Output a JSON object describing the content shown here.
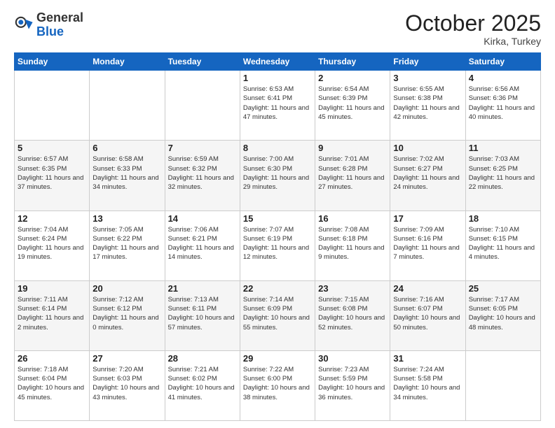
{
  "header": {
    "logo_general": "General",
    "logo_blue": "Blue",
    "month_title": "October 2025",
    "subtitle": "Kirka, Turkey"
  },
  "weekdays": [
    "Sunday",
    "Monday",
    "Tuesday",
    "Wednesday",
    "Thursday",
    "Friday",
    "Saturday"
  ],
  "weeks": [
    [
      {
        "day": "",
        "sunrise": "",
        "sunset": "",
        "daylight": ""
      },
      {
        "day": "",
        "sunrise": "",
        "sunset": "",
        "daylight": ""
      },
      {
        "day": "",
        "sunrise": "",
        "sunset": "",
        "daylight": ""
      },
      {
        "day": "1",
        "sunrise": "Sunrise: 6:53 AM",
        "sunset": "Sunset: 6:41 PM",
        "daylight": "Daylight: 11 hours and 47 minutes."
      },
      {
        "day": "2",
        "sunrise": "Sunrise: 6:54 AM",
        "sunset": "Sunset: 6:39 PM",
        "daylight": "Daylight: 11 hours and 45 minutes."
      },
      {
        "day": "3",
        "sunrise": "Sunrise: 6:55 AM",
        "sunset": "Sunset: 6:38 PM",
        "daylight": "Daylight: 11 hours and 42 minutes."
      },
      {
        "day": "4",
        "sunrise": "Sunrise: 6:56 AM",
        "sunset": "Sunset: 6:36 PM",
        "daylight": "Daylight: 11 hours and 40 minutes."
      }
    ],
    [
      {
        "day": "5",
        "sunrise": "Sunrise: 6:57 AM",
        "sunset": "Sunset: 6:35 PM",
        "daylight": "Daylight: 11 hours and 37 minutes."
      },
      {
        "day": "6",
        "sunrise": "Sunrise: 6:58 AM",
        "sunset": "Sunset: 6:33 PM",
        "daylight": "Daylight: 11 hours and 34 minutes."
      },
      {
        "day": "7",
        "sunrise": "Sunrise: 6:59 AM",
        "sunset": "Sunset: 6:32 PM",
        "daylight": "Daylight: 11 hours and 32 minutes."
      },
      {
        "day": "8",
        "sunrise": "Sunrise: 7:00 AM",
        "sunset": "Sunset: 6:30 PM",
        "daylight": "Daylight: 11 hours and 29 minutes."
      },
      {
        "day": "9",
        "sunrise": "Sunrise: 7:01 AM",
        "sunset": "Sunset: 6:28 PM",
        "daylight": "Daylight: 11 hours and 27 minutes."
      },
      {
        "day": "10",
        "sunrise": "Sunrise: 7:02 AM",
        "sunset": "Sunset: 6:27 PM",
        "daylight": "Daylight: 11 hours and 24 minutes."
      },
      {
        "day": "11",
        "sunrise": "Sunrise: 7:03 AM",
        "sunset": "Sunset: 6:25 PM",
        "daylight": "Daylight: 11 hours and 22 minutes."
      }
    ],
    [
      {
        "day": "12",
        "sunrise": "Sunrise: 7:04 AM",
        "sunset": "Sunset: 6:24 PM",
        "daylight": "Daylight: 11 hours and 19 minutes."
      },
      {
        "day": "13",
        "sunrise": "Sunrise: 7:05 AM",
        "sunset": "Sunset: 6:22 PM",
        "daylight": "Daylight: 11 hours and 17 minutes."
      },
      {
        "day": "14",
        "sunrise": "Sunrise: 7:06 AM",
        "sunset": "Sunset: 6:21 PM",
        "daylight": "Daylight: 11 hours and 14 minutes."
      },
      {
        "day": "15",
        "sunrise": "Sunrise: 7:07 AM",
        "sunset": "Sunset: 6:19 PM",
        "daylight": "Daylight: 11 hours and 12 minutes."
      },
      {
        "day": "16",
        "sunrise": "Sunrise: 7:08 AM",
        "sunset": "Sunset: 6:18 PM",
        "daylight": "Daylight: 11 hours and 9 minutes."
      },
      {
        "day": "17",
        "sunrise": "Sunrise: 7:09 AM",
        "sunset": "Sunset: 6:16 PM",
        "daylight": "Daylight: 11 hours and 7 minutes."
      },
      {
        "day": "18",
        "sunrise": "Sunrise: 7:10 AM",
        "sunset": "Sunset: 6:15 PM",
        "daylight": "Daylight: 11 hours and 4 minutes."
      }
    ],
    [
      {
        "day": "19",
        "sunrise": "Sunrise: 7:11 AM",
        "sunset": "Sunset: 6:14 PM",
        "daylight": "Daylight: 11 hours and 2 minutes."
      },
      {
        "day": "20",
        "sunrise": "Sunrise: 7:12 AM",
        "sunset": "Sunset: 6:12 PM",
        "daylight": "Daylight: 11 hours and 0 minutes."
      },
      {
        "day": "21",
        "sunrise": "Sunrise: 7:13 AM",
        "sunset": "Sunset: 6:11 PM",
        "daylight": "Daylight: 10 hours and 57 minutes."
      },
      {
        "day": "22",
        "sunrise": "Sunrise: 7:14 AM",
        "sunset": "Sunset: 6:09 PM",
        "daylight": "Daylight: 10 hours and 55 minutes."
      },
      {
        "day": "23",
        "sunrise": "Sunrise: 7:15 AM",
        "sunset": "Sunset: 6:08 PM",
        "daylight": "Daylight: 10 hours and 52 minutes."
      },
      {
        "day": "24",
        "sunrise": "Sunrise: 7:16 AM",
        "sunset": "Sunset: 6:07 PM",
        "daylight": "Daylight: 10 hours and 50 minutes."
      },
      {
        "day": "25",
        "sunrise": "Sunrise: 7:17 AM",
        "sunset": "Sunset: 6:05 PM",
        "daylight": "Daylight: 10 hours and 48 minutes."
      }
    ],
    [
      {
        "day": "26",
        "sunrise": "Sunrise: 7:18 AM",
        "sunset": "Sunset: 6:04 PM",
        "daylight": "Daylight: 10 hours and 45 minutes."
      },
      {
        "day": "27",
        "sunrise": "Sunrise: 7:20 AM",
        "sunset": "Sunset: 6:03 PM",
        "daylight": "Daylight: 10 hours and 43 minutes."
      },
      {
        "day": "28",
        "sunrise": "Sunrise: 7:21 AM",
        "sunset": "Sunset: 6:02 PM",
        "daylight": "Daylight: 10 hours and 41 minutes."
      },
      {
        "day": "29",
        "sunrise": "Sunrise: 7:22 AM",
        "sunset": "Sunset: 6:00 PM",
        "daylight": "Daylight: 10 hours and 38 minutes."
      },
      {
        "day": "30",
        "sunrise": "Sunrise: 7:23 AM",
        "sunset": "Sunset: 5:59 PM",
        "daylight": "Daylight: 10 hours and 36 minutes."
      },
      {
        "day": "31",
        "sunrise": "Sunrise: 7:24 AM",
        "sunset": "Sunset: 5:58 PM",
        "daylight": "Daylight: 10 hours and 34 minutes."
      },
      {
        "day": "",
        "sunrise": "",
        "sunset": "",
        "daylight": ""
      }
    ]
  ]
}
